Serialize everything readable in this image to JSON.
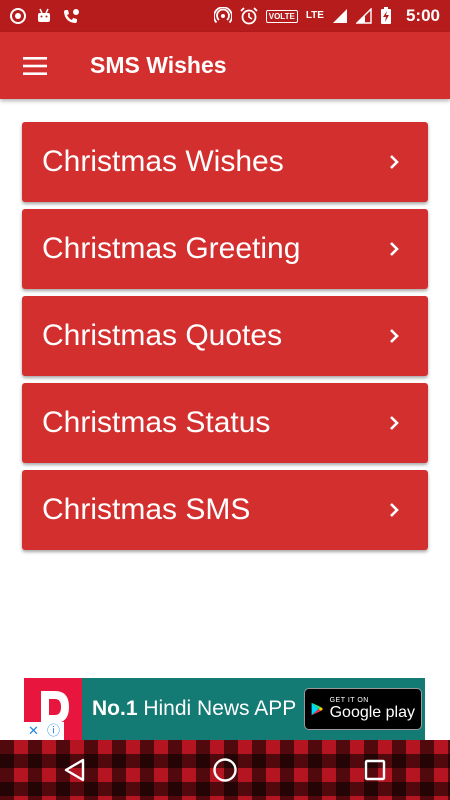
{
  "status_bar": {
    "left_icons": [
      "record-icon",
      "android-icon",
      "missed-call-icon"
    ],
    "right_icons": [
      "hotspot-icon",
      "alarm-icon",
      "signal-icon",
      "battery-charging-icon"
    ],
    "volte": "VOLTE",
    "network": "LTE",
    "time": "5:00"
  },
  "app_bar": {
    "title": "SMS Wishes",
    "menu_icon": "hamburger-menu-icon",
    "color": "#d32f2f"
  },
  "menu": {
    "items": [
      {
        "label": "Christmas Wishes"
      },
      {
        "label": "Christmas Greeting"
      },
      {
        "label": "Christmas Quotes"
      },
      {
        "label": "Christmas Status"
      },
      {
        "label": "Christmas SMS"
      }
    ],
    "item_icon": "chevron-right-icon",
    "card_color": "#d32f2f"
  },
  "ad": {
    "headline_bold": "No.1",
    "headline_rest": " Hindi News APP",
    "badge_small": "GET IT ON",
    "badge_big": "Google play",
    "background": "#137a74"
  },
  "nav_bar": {
    "icons": [
      "back-icon",
      "home-icon",
      "recents-icon"
    ]
  }
}
